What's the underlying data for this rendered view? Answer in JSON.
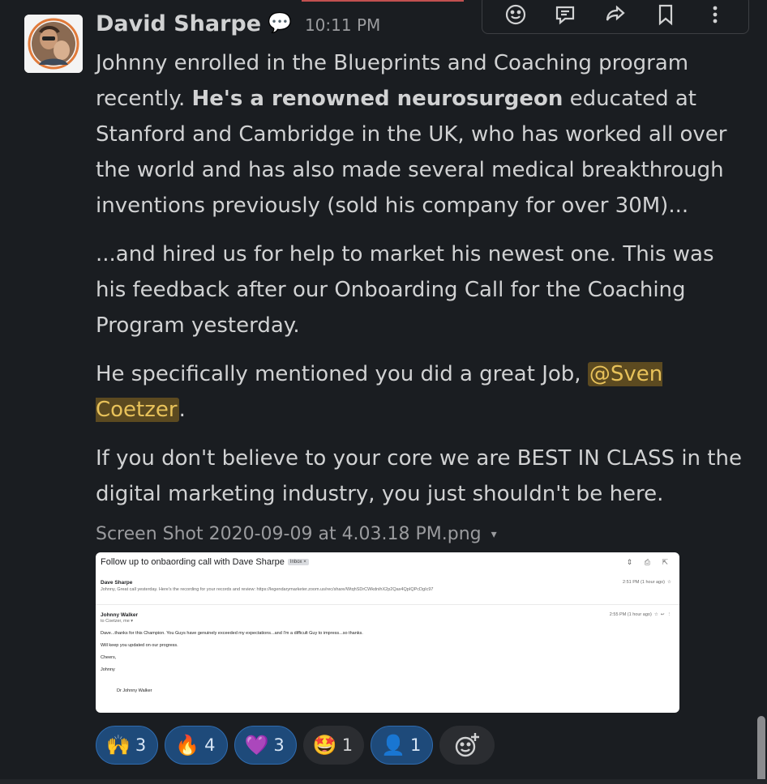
{
  "message": {
    "author": "David Sharpe",
    "status_emoji": "💬",
    "timestamp": "10:11 PM",
    "paragraph1_a": "Johnny enrolled in the Blueprints and Coaching program recently. ",
    "paragraph1_bold": "He's a renowned neurosurgeon",
    "paragraph1_b": " educated at Stanford and Cambridge in the UK, who has worked all over the world and has also made several medical breakthrough inventions previously (sold his company for over 30M)...",
    "paragraph2": "...and hired us for help to market his newest one. This was his feedback after our Onboarding Call for the Coaching Program yesterday.",
    "paragraph3_a": "He specifically mentioned you did a great Job, ",
    "paragraph3_mention": "@Sven Coetzer",
    "paragraph3_b": ".",
    "paragraph4": "If you don't believe to your core we are BEST IN CLASS in the digital marketing industry, you just shouldn't be here.",
    "file_name": "Screen Shot 2020-09-09 at 4.03.18 PM.png",
    "file_caret": "▾"
  },
  "toolbar": {
    "items": [
      {
        "icon": "emoji-reaction-icon"
      },
      {
        "icon": "reply-thread-icon"
      },
      {
        "icon": "share-icon"
      },
      {
        "icon": "bookmark-icon"
      },
      {
        "icon": "more-actions-icon"
      }
    ]
  },
  "email_preview": {
    "subject": "Follow up to onbaording call with Dave Sharpe",
    "tag": "Inbox ×",
    "m1_sender": "Dave Sharpe",
    "m1_snippet": "Johnny, Great call yesterday. Here's the recording for your records and review: https://legendarymarketer.zoom.us/rec/share/WtqhSDrCWkdnihX2p2Qax4QpIQPcDgIc97",
    "m1_time": "2:51 PM (1 hour ago)",
    "m2_sender": "Johnny Walker",
    "m2_to": "to Coetzer, me ▾",
    "m2_time": "2:55 PM (1 hour ago)",
    "m2_line1": "Dave...thanks for this Champion. You Guys have genuinely exceeded my expectations...and I'm a difficult Guy to impress...so thanks.",
    "m2_line2": "Will keep you updated on our progress.",
    "m2_line3": "Cheers,",
    "m2_line4": "Johnny",
    "m2_sig": "Dr Johnny Walker"
  },
  "reactions": [
    {
      "emoji": "🙌",
      "count": "3",
      "mine": true
    },
    {
      "emoji": "🔥",
      "count": "4",
      "mine": true
    },
    {
      "emoji": "💜",
      "count": "3",
      "mine": true
    },
    {
      "emoji": "🤩",
      "count": "1",
      "mine": false
    },
    {
      "emoji": "👤",
      "count": "1",
      "mine": true
    }
  ],
  "colors": {
    "background": "#1a1d21",
    "mention_bg": "#5c4a20",
    "mention_text": "#e8c25a",
    "reaction_active": "#1e4a7a"
  }
}
